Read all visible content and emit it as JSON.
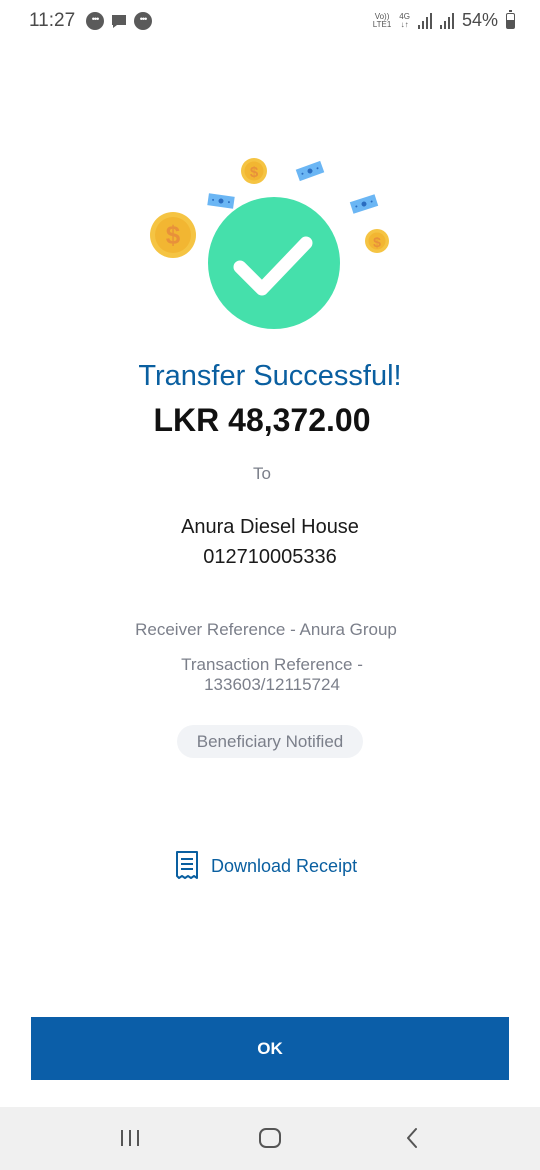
{
  "status_bar": {
    "time": "11:27",
    "network_top": "Vo))",
    "network_bottom": "LTE1",
    "network_type": "4G",
    "battery": "54%",
    "battery_level": 0.54
  },
  "illustration": {
    "check_color": "#45e0ab",
    "coin_color": "#f5c443",
    "bill_color": "#6bb6f4"
  },
  "result": {
    "title": "Transfer Successful!",
    "amount": "LKR 48,372.00",
    "to_label": "To",
    "payee_name": "Anura Diesel House",
    "payee_account": "012710005336",
    "receiver_reference": "Receiver Reference - Anura Group",
    "transaction_reference_line1": "Transaction Reference -",
    "transaction_reference_line2": "133603/12115724",
    "badge": "Beneficiary Notified"
  },
  "actions": {
    "download_label": "Download Receipt",
    "download_icon": "receipt-icon",
    "ok_label": "OK"
  },
  "colors": {
    "primary": "#0b5ea8",
    "title": "#0a5fa0",
    "muted_text": "#7b7f8a"
  },
  "nav": {
    "recents_icon": "recents-icon",
    "home_icon": "home-icon",
    "back_icon": "back-icon"
  }
}
